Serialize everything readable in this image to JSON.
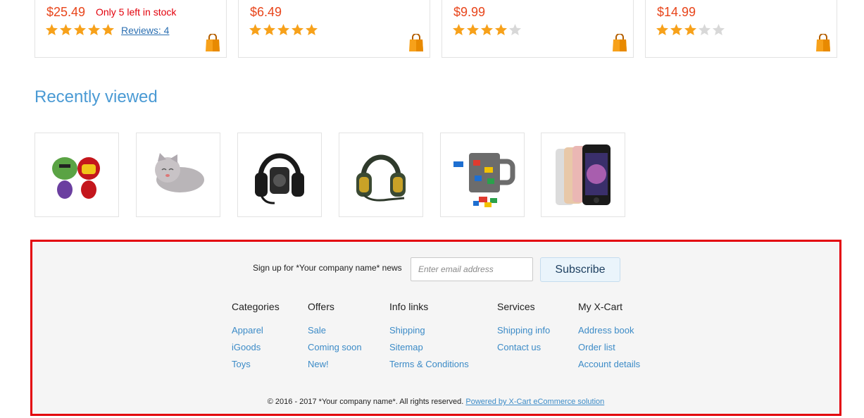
{
  "products": [
    {
      "price": "$25.49",
      "stock": "Only 5 left in stock",
      "rating": 5,
      "reviews": "Reviews: 4"
    },
    {
      "price": "$6.49",
      "stock": "",
      "rating": 5,
      "reviews": ""
    },
    {
      "price": "$9.99",
      "stock": "",
      "rating": 4,
      "reviews": ""
    },
    {
      "price": "$14.99",
      "stock": "",
      "rating": 3,
      "reviews": ""
    }
  ],
  "recently_viewed": {
    "title": "Recently viewed",
    "items": [
      "hulk-ironman-plush-icon",
      "grey-cat-plush-icon",
      "black-headset-icon",
      "green-headset-icon",
      "brick-mug-icon",
      "iphone-se-icon"
    ]
  },
  "footer": {
    "signup_label": "Sign up for *Your company name* news",
    "email_placeholder": "Enter email address",
    "subscribe_label": "Subscribe",
    "columns": [
      {
        "title": "Categories",
        "links": [
          "Apparel",
          "iGoods",
          "Toys"
        ]
      },
      {
        "title": "Offers",
        "links": [
          "Sale",
          "Coming soon",
          "New!"
        ]
      },
      {
        "title": "Info links",
        "links": [
          "Shipping",
          "Sitemap",
          "Terms & Conditions"
        ]
      },
      {
        "title": "Services",
        "links": [
          "Shipping info",
          "Contact us"
        ]
      },
      {
        "title": "My X-Cart",
        "links": [
          "Address book",
          "Order list",
          "Account details"
        ]
      }
    ],
    "copyright": "© 2016 - 2017 *Your company name*. All rights reserved.",
    "powered_by": "Powered by X-Cart eCommerce solution"
  },
  "colors": {
    "star_on": "#f7a11a",
    "star_off": "#d8d8d8",
    "price": "#e8451b",
    "link": "#3c8bc7",
    "highlight_border": "#e3000b"
  }
}
